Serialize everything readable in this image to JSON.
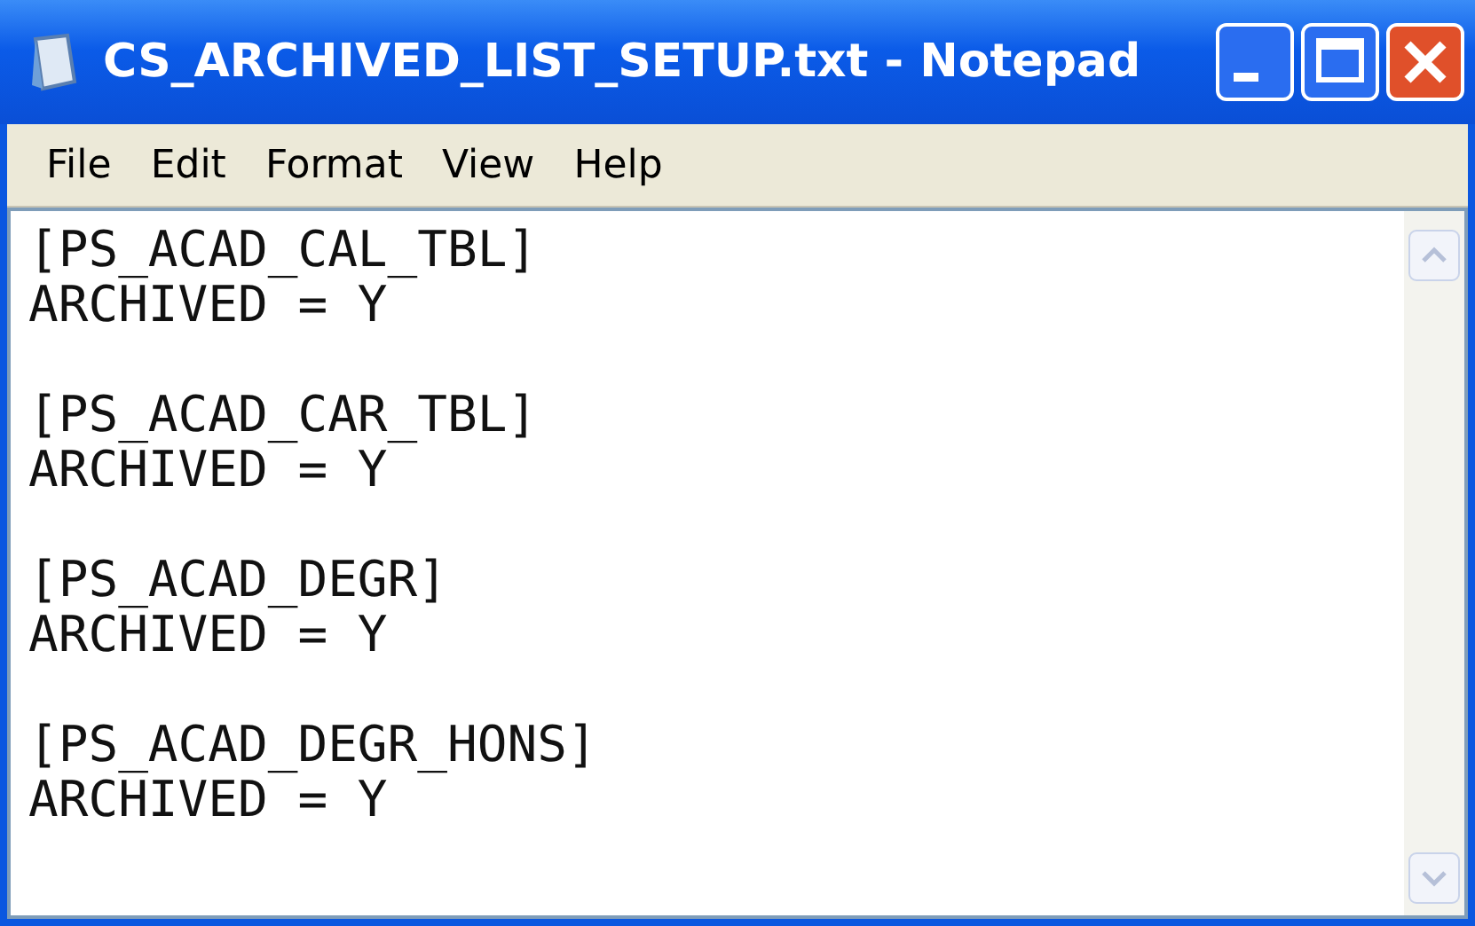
{
  "window": {
    "title": "CS_ARCHIVED_LIST_SETUP.txt - Notepad"
  },
  "menu": [
    "File",
    "Edit",
    "Format",
    "View",
    "Help"
  ],
  "editor": {
    "entries": [
      {
        "section": "[PS_ACAD_CAL_TBL]",
        "setting": "ARCHIVED = Y"
      },
      {
        "section": "[PS_ACAD_CAR_TBL]",
        "setting": "ARCHIVED = Y"
      },
      {
        "section": "[PS_ACAD_DEGR]",
        "setting": "ARCHIVED = Y"
      },
      {
        "section": "[PS_ACAD_DEGR_HONS]",
        "setting": "ARCHIVED = Y"
      }
    ]
  }
}
